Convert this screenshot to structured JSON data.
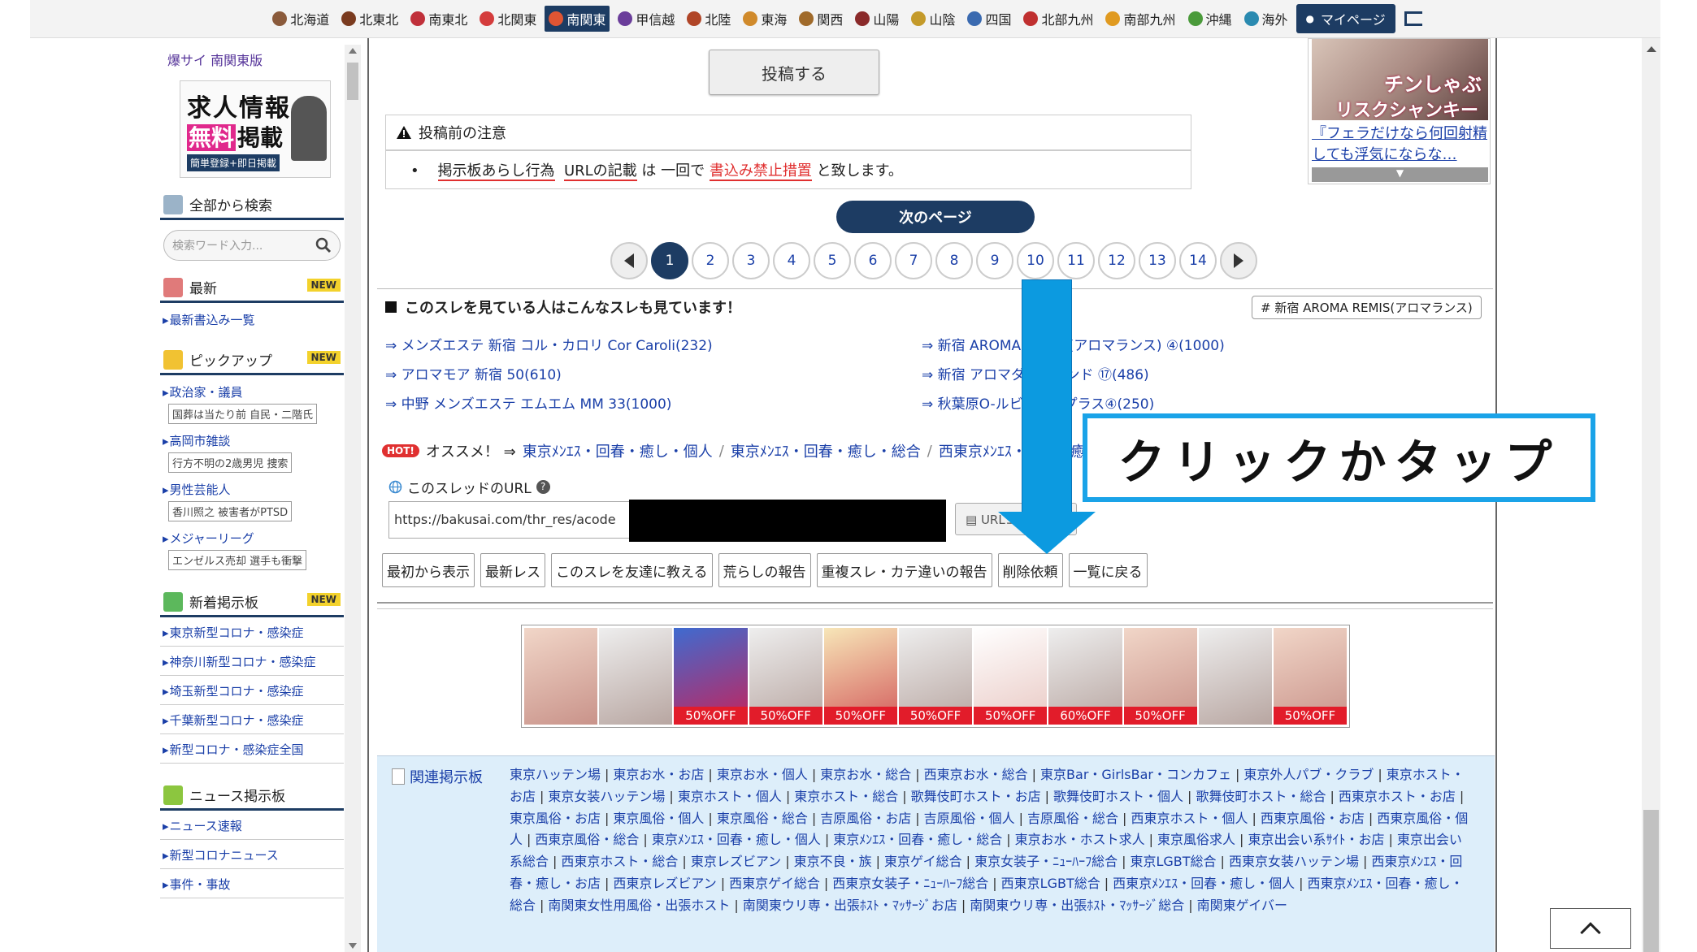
{
  "topnav": {
    "regions": [
      {
        "label": "北海道",
        "color": "#8a5a3b"
      },
      {
        "label": "北東北",
        "color": "#7a3b1f"
      },
      {
        "label": "南東北",
        "color": "#c0303a"
      },
      {
        "label": "北関東",
        "color": "#d43c3c"
      },
      {
        "label": "南関東",
        "color": "#e05533",
        "active": true
      },
      {
        "label": "甲信越",
        "color": "#6a3d9a"
      },
      {
        "label": "北陸",
        "color": "#b04527"
      },
      {
        "label": "東海",
        "color": "#d08a2b"
      },
      {
        "label": "関西",
        "color": "#a06a2a"
      },
      {
        "label": "山陽",
        "color": "#8a2a2a"
      },
      {
        "label": "山陰",
        "color": "#c49a2a"
      },
      {
        "label": "四国",
        "color": "#3a6ab0"
      },
      {
        "label": "北部九州",
        "color": "#c03030"
      },
      {
        "label": "南部九州",
        "color": "#e09a20"
      },
      {
        "label": "沖縄",
        "color": "#4a9a3a"
      },
      {
        "label": "海外",
        "color": "#2a8ab0"
      }
    ],
    "mypage": "マイページ"
  },
  "sidebar": {
    "edition": "爆サイ 南関東版",
    "banner": {
      "line1": "求人情報",
      "line2a": "無料",
      "line2b": "掲載",
      "line3": "簡単登録+即日掲載"
    },
    "search_title": "全部から検索",
    "search_placeholder": "検索ワード入力...",
    "latest_title": "最新",
    "new_badge": "NEW",
    "latest_link": "最新書込み一覧",
    "pickup_title": "ピックアップ",
    "pickups": [
      {
        "title": "政治家・議員",
        "sub": "国葬は当たり前 自民・二階氏"
      },
      {
        "title": "高岡市雑談",
        "sub": "行方不明の2歳男児 捜索"
      },
      {
        "title": "男性芸能人",
        "sub": "香川照之 被害者がPTSD"
      },
      {
        "title": "メジャーリーグ",
        "sub": "エンゼルス売却 選手も衝撃"
      }
    ],
    "boards_title": "新着掲示板",
    "boards": [
      "東京新型コロナ・感染症",
      "神奈川新型コロナ・感染症",
      "埼玉新型コロナ・感染症",
      "千葉新型コロナ・感染症",
      "新型コロナ・感染症全国"
    ],
    "news_title": "ニュース掲示板",
    "news": [
      "ニュース速報",
      "新型コロナニュース",
      "事件・事故"
    ]
  },
  "main": {
    "post_button": "投稿する",
    "notice_title": "投稿前の注意",
    "notice_body": {
      "a": "掲示板あらし行為",
      "b": "URLの記載",
      "c": "は 一回で",
      "d": "書込み禁止措置",
      "e": "と致します。"
    },
    "side_ad": {
      "t1": "チンしゃぶ",
      "t2": "リスクシャンキー",
      "caption": "『フェラだけなら何回射精しても浮気にならな…",
      "more": "▼"
    },
    "next_page": "次のページ",
    "pages": [
      "1",
      "2",
      "3",
      "4",
      "5",
      "6",
      "7",
      "8",
      "9",
      "10",
      "11",
      "12",
      "13",
      "14"
    ],
    "current_page": "1",
    "related_title": "このスレを見ている人はこんなスレも見ています！",
    "tag": "# 新宿 AROMA REMIS(アロマランス)",
    "related_left": [
      "メンズエステ 新宿 コル・カロリ Cor Caroli(232)",
      "アロマモア 新宿 50(610)",
      "中野 メンズエステ エムエム MM 33(1000)"
    ],
    "related_right": [
      "新宿 AROMA REMIS(アロマランス) ④(1000)",
      "新宿 アロマダイヤモンド ⑰(486)",
      "秋葉原O-ルビーオープラス④(250)"
    ],
    "hot_label": "HOT!",
    "reco_label": "オススメ！ ⇒",
    "reco_links": [
      "東京ﾒﾝｴｽ・回春・癒し・個人",
      "東京ﾒﾝｴｽ・回春・癒し・総合",
      "西東京ﾒﾝｴｽ・回春・癒し"
    ],
    "url_label": "このスレッドのURL",
    "url_value": "https://bakusai.com/thr_res/acode",
    "copy_label": "URLコピー",
    "actions": [
      "最初から表示",
      "最新レス",
      "このスレを友達に教える",
      "荒らしの報告",
      "重複スレ・カテ違いの報告",
      "削除依頼",
      "一覧に戻る"
    ],
    "ad_offs": [
      "",
      "",
      "50%OFF",
      "50%OFF",
      "50%OFF",
      "50%OFF",
      "50%OFF",
      "60%OFF",
      "50%OFF",
      "",
      "50%OFF"
    ],
    "relboard_title": "関連掲示板",
    "relboard_links": [
      "東京ハッテン場",
      "東京お水・お店",
      "東京お水・個人",
      "東京お水・総合",
      "西東京お水・総合",
      "東京Bar・GirlsBar・コンカフェ",
      "東京外人パブ・クラブ",
      "東京ホスト・お店",
      "東京女装ハッテン場",
      "東京ホスト・個人",
      "東京ホスト・総合",
      "歌舞伎町ホスト・お店",
      "歌舞伎町ホスト・個人",
      "歌舞伎町ホスト・総合",
      "西東京ホスト・お店",
      "東京風俗・お店",
      "東京風俗・個人",
      "東京風俗・総合",
      "吉原風俗・お店",
      "吉原風俗・個人",
      "吉原風俗・総合",
      "西東京ホスト・個人",
      "西東京風俗・お店",
      "西東京風俗・個人",
      "西東京風俗・総合",
      "東京ﾒﾝｴｽ・回春・癒し・個人",
      "東京ﾒﾝｴｽ・回春・癒し・総合",
      "東京お水・ホスト求人",
      "東京風俗求人",
      "東京出会い系ｻｲﾄ・お店",
      "東京出会い系総合",
      "西東京ホスト・総合",
      "東京レズビアン",
      "東京不良・族",
      "東京ゲイ総合",
      "東京女装子・ﾆｭｰﾊｰﾌ総合",
      "東京LGBT総合",
      "西東京女装ハッテン場",
      "西東京ﾒﾝｴｽ・回春・癒し・お店",
      "西東京レズビアン",
      "西東京ゲイ総合",
      "西東京女装子・ﾆｭｰﾊｰﾌ総合",
      "西東京LGBT総合",
      "西東京ﾒﾝｴｽ・回春・癒し・個人",
      "西東京ﾒﾝｴｽ・回春・癒し・総合",
      "南関東女性用風俗・出張ホスト",
      "南関東ウリ専・出張ﾎｽﾄ・ﾏｯｻｰｼﾞお店",
      "南関東ウリ専・出張ﾎｽﾄ・ﾏｯｻｰｼﾞ総合",
      "南関東ゲイバー"
    ]
  },
  "annotation": {
    "text": "クリックかタップ",
    "color": "#0c9ae0"
  }
}
